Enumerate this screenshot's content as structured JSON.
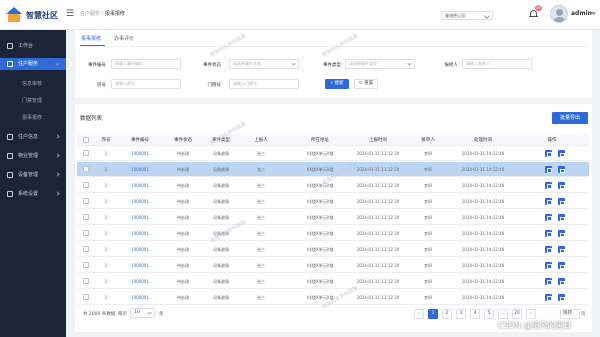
{
  "app": {
    "title": "智慧社区"
  },
  "breadcrumb": {
    "parent": "住户服务",
    "sep": "/",
    "current": "报事报修"
  },
  "header": {
    "community": "童城德公园",
    "bell_count": "20",
    "user": "admin"
  },
  "sidebar": {
    "items": [
      {
        "label": "工作台"
      },
      {
        "label": "住户服务"
      },
      {
        "label": "住户信息"
      },
      {
        "label": "物业管理"
      },
      {
        "label": "设备管理"
      },
      {
        "label": "系统设置"
      }
    ],
    "sub": [
      {
        "label": "信息审核"
      },
      {
        "label": "门禁管理"
      },
      {
        "label": "报事报修"
      }
    ]
  },
  "tabs": [
    {
      "label": "报事报修"
    },
    {
      "label": "办事评价"
    }
  ],
  "filters": {
    "labels": {
      "event_no": "事件编号",
      "status": "事件状态",
      "type": "事件类型",
      "reporter": "报修人",
      "house": "房号",
      "door": "门牌号"
    },
    "placeholders": {
      "event_no": "请输入事件编号",
      "status": "请选择事件状态",
      "type": "请选择事件类型",
      "reporter": "请输入报修人",
      "house": "请输入房号",
      "door": "请输入门牌号"
    },
    "search": "搜索",
    "reset": "重置"
  },
  "list": {
    "title": "数据列表",
    "batch": "批量导出"
  },
  "table": {
    "headers": [
      "序号",
      "事件编号",
      "事件状态",
      "事件类型",
      "上报人",
      "所在地址",
      "上报时间",
      "接单人",
      "处理时间",
      "操作"
    ],
    "rows": [
      [
        "1",
        "1000001",
        "待处理",
        "设备故障",
        "张三",
        "XX楼X单元X楼",
        "2024-01-31 11:12:30",
        "李四",
        "2024-01-31 14:12:40"
      ],
      [
        "1",
        "1000001",
        "待处理",
        "设备故障",
        "张三",
        "XX楼X单元X楼",
        "2024-01-31 11:12:30",
        "李四",
        "2024-01-31 14:12:40"
      ],
      [
        "1",
        "1000001",
        "待处理",
        "设备故障",
        "张三",
        "XX楼X单元X楼",
        "2024-01-31 11:12:30",
        "李四",
        "2024-01-31 14:12:40"
      ],
      [
        "1",
        "1000001",
        "待处理",
        "设备故障",
        "张三",
        "XX楼X单元X楼",
        "2024-01-31 11:12:30",
        "李四",
        "2024-01-31 14:12:40"
      ],
      [
        "1",
        "1000001",
        "待处理",
        "设备故障",
        "张三",
        "XX楼X单元X楼",
        "2024-01-31 11:12:30",
        "李四",
        "2024-01-31 14:12:40"
      ],
      [
        "1",
        "1000001",
        "待处理",
        "设备故障",
        "张三",
        "XX楼X单元X楼",
        "2024-01-31 11:12:30",
        "李四",
        "2024-01-31 14:12:40"
      ],
      [
        "1",
        "1000001",
        "待处理",
        "设备故障",
        "张三",
        "XX楼X单元X楼",
        "2024-01-31 11:12:30",
        "李四",
        "2024-01-31 14:12:40"
      ],
      [
        "1",
        "1000001",
        "待处理",
        "设备故障",
        "张三",
        "XX楼X单元X楼",
        "2024-01-31 11:12:30",
        "李四",
        "2024-01-31 14:12:40"
      ],
      [
        "1",
        "1000001",
        "待处理",
        "设备故障",
        "张三",
        "XX楼X单元X楼",
        "2024-01-31 11:12:30",
        "李四",
        "2024-01-31 14:12:40"
      ],
      [
        "1",
        "1000001",
        "待处理",
        "设备故障",
        "张三",
        "XX楼X单元X楼",
        "2024-01-31 11:12:30",
        "李四",
        "2024-01-31 14:12:40"
      ]
    ],
    "highlight_row": 1
  },
  "pagination": {
    "total": "共 2000 条数据",
    "per_label": "每页",
    "per_value": "10",
    "per_unit": "条",
    "pages": [
      "‹",
      "1",
      "2",
      "3",
      "4",
      "5",
      "…",
      "20",
      "›"
    ],
    "current": "1",
    "jump_label": "跳转",
    "page_unit": "页"
  },
  "watermark": "我是的名字叫我是",
  "csdn": "CSDN @招风的黑耳",
  "colors": {
    "accent": "#2f6bd8",
    "sidebar": "#1c2538",
    "highlight": "#bcd5f2"
  }
}
